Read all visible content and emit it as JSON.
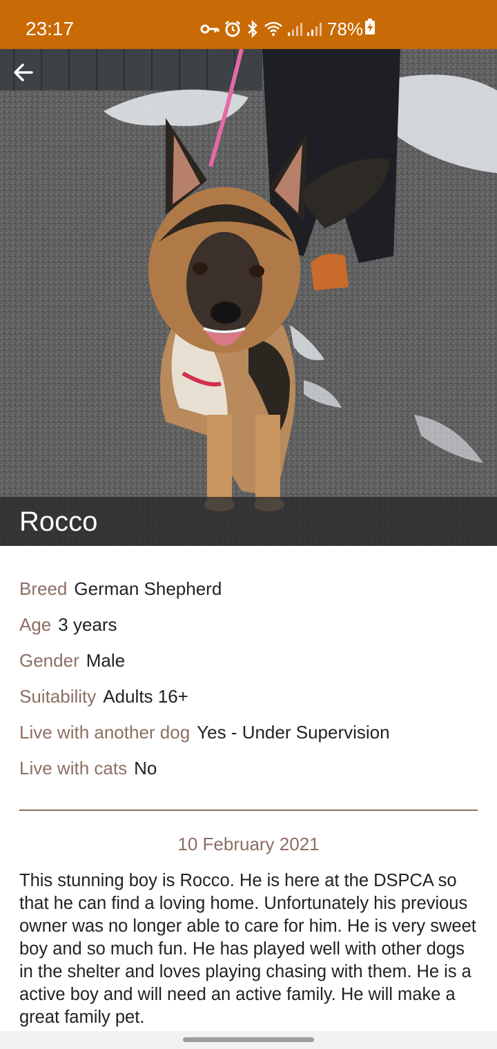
{
  "status_bar": {
    "time": "23:17",
    "battery": "78%",
    "icons": [
      "vpn-key-icon",
      "alarm-icon",
      "bluetooth-icon",
      "wifi-icon",
      "signal-icon",
      "signal-icon",
      "battery-charging-icon"
    ],
    "background_color": "#c86a05"
  },
  "header": {
    "back_icon": "arrow-left-icon",
    "dog_name": "Rocco"
  },
  "details": [
    {
      "label": "Breed",
      "value": "German Shepherd"
    },
    {
      "label": "Age",
      "value": "3 years"
    },
    {
      "label": "Gender",
      "value": "Male"
    },
    {
      "label": "Suitability",
      "value": "Adults 16+"
    },
    {
      "label": "Live with another dog",
      "value": "Yes - Under Supervision"
    },
    {
      "label": "Live with cats",
      "value": "No"
    }
  ],
  "date": "10 February 2021",
  "description": "This stunning boy is Rocco. He is here at the DSPCA so that he can find a loving home. Unfortunately his previous owner was no longer able to care for him. He is very sweet boy and so much fun. He has played well with other dogs in the shelter and loves playing chasing with them. He is a active boy and will need an active family. He will make a great family pet.",
  "colors": {
    "accent": "#c86a05",
    "label": "#8d6e63",
    "text": "#222222"
  }
}
